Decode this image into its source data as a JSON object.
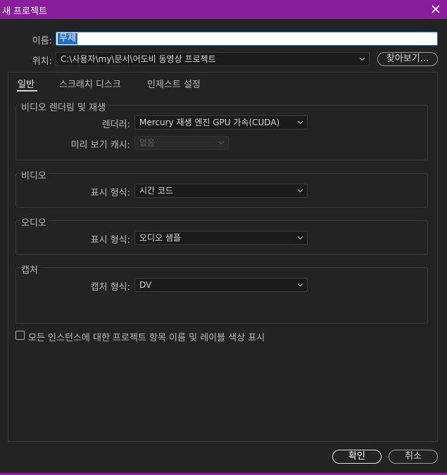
{
  "window": {
    "title": "새 프로젝트",
    "accent_color": "#8a1d9c",
    "close_icon": "close-icon"
  },
  "name_field": {
    "label": "이름:",
    "value": "무제"
  },
  "location_field": {
    "label": "위치:",
    "value": "C:\\사용자\\my\\문서\\어도비 동영상 프로젝트",
    "browse_label": "찾아보기..."
  },
  "tabs": [
    {
      "label": "일반",
      "active": true
    },
    {
      "label": "스크래치 디스크",
      "active": false
    },
    {
      "label": "인제스트 설정",
      "active": false
    }
  ],
  "video_rendering": {
    "title": "비디오 렌더링 및 재생",
    "renderer_label": "렌더러:",
    "renderer_value": "Mercury 재생 엔진 GPU 가속(CUDA)",
    "preview_cache_label": "미리 보기 캐시:",
    "preview_cache_value": "없음"
  },
  "video": {
    "title": "비디오",
    "display_format_label": "표시 형식:",
    "display_format_value": "시간 코드"
  },
  "audio": {
    "title": "오디오",
    "display_format_label": "표시 형식:",
    "display_format_value": "오디오 샘플"
  },
  "capture": {
    "title": "캡처",
    "format_label": "캡처 형식:",
    "format_value": "DV"
  },
  "options": {
    "show_labels_label": "모든 인스턴스에 대한 프로젝트 항목 이름 및 레이블 색상 표시",
    "show_labels_checked": false
  },
  "footer": {
    "ok_label": "확인",
    "cancel_label": "취소"
  }
}
